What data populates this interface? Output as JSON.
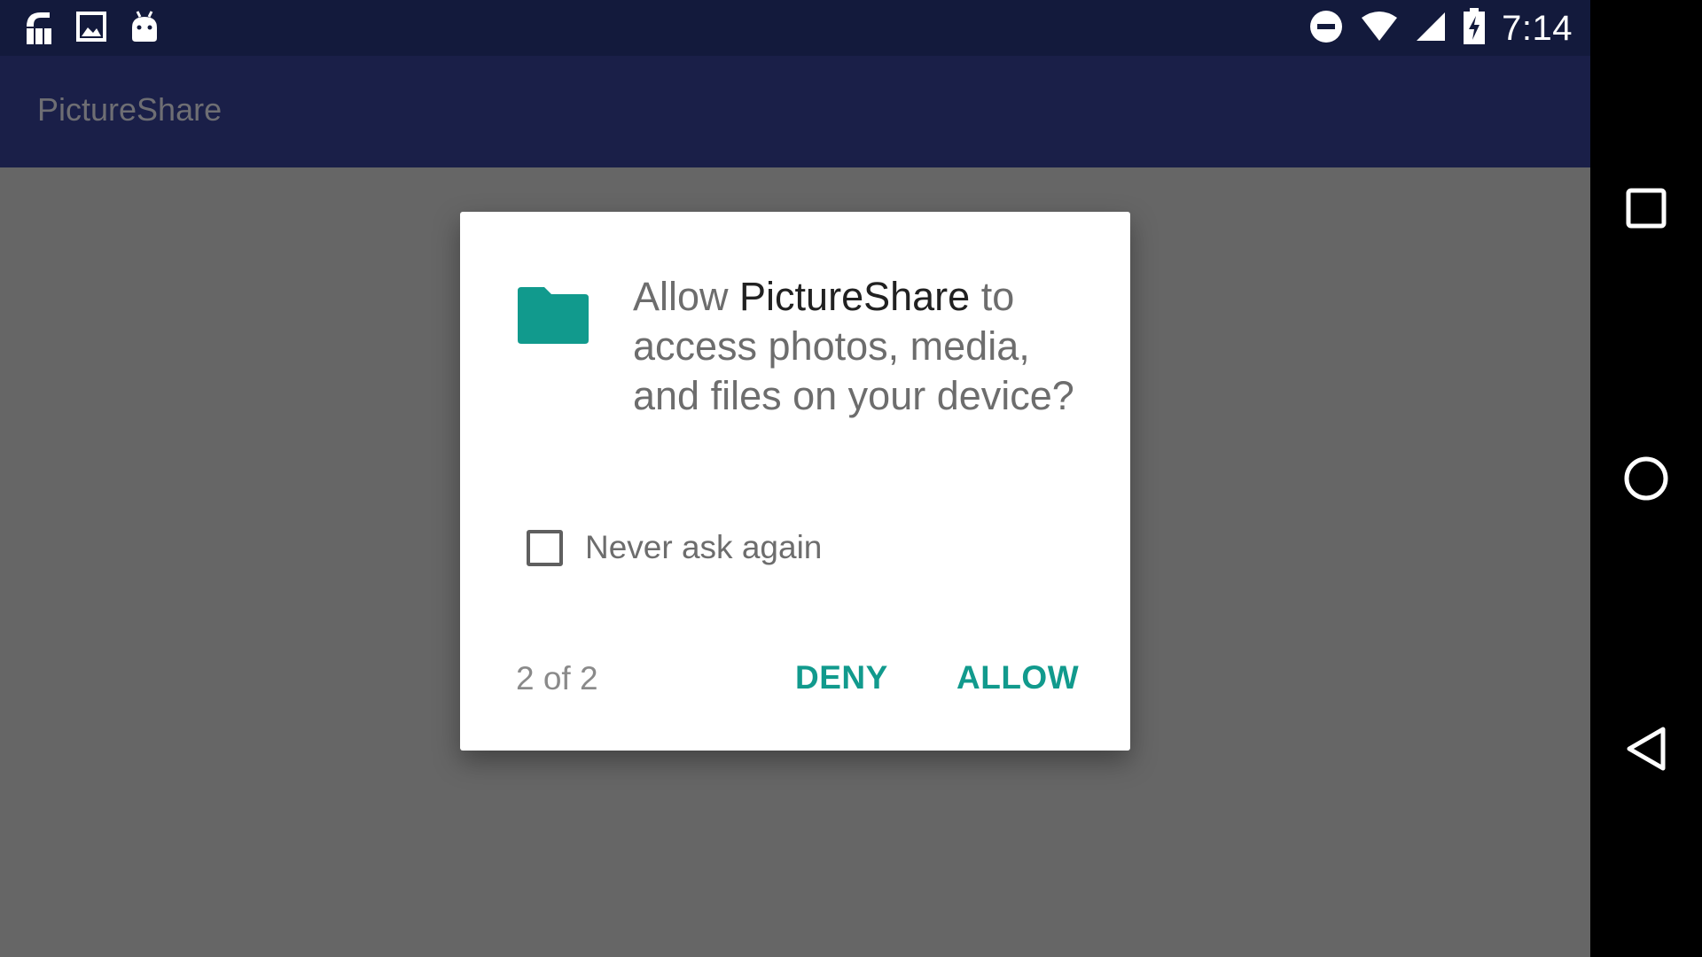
{
  "status_bar": {
    "time": "7:14",
    "left_icons": [
      "notification-f-icon",
      "image-icon",
      "android-icon"
    ],
    "right_icons": [
      "do-not-disturb-icon",
      "wifi-icon",
      "cell-signal-icon",
      "battery-charging-icon"
    ]
  },
  "app_bar": {
    "title": "PictureShare"
  },
  "dialog": {
    "icon": "folder-icon",
    "message_prefix": "Allow ",
    "message_app": "PictureShare",
    "message_suffix": " to access photos, media, and files on your device?",
    "checkbox_label": "Never ask again",
    "checkbox_checked": false,
    "counter": "2 of 2",
    "deny_label": "DENY",
    "allow_label": "ALLOW"
  },
  "nav_bar": {
    "buttons": [
      "recents-square-icon",
      "home-circle-icon",
      "back-triangle-icon"
    ]
  },
  "colors": {
    "status_bar": "#131a3c",
    "app_bar": "#1a1f48",
    "scrim_background": "#666666",
    "accent": "#119a8d"
  }
}
